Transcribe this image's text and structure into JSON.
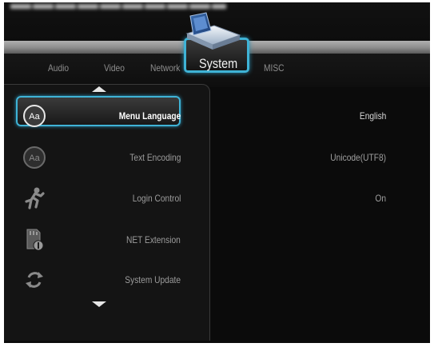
{
  "tabs": [
    {
      "label": "Audio",
      "active": false
    },
    {
      "label": "Video",
      "active": false
    },
    {
      "label": "Network",
      "active": false
    },
    {
      "label": "System",
      "active": true
    },
    {
      "label": "MISC",
      "active": false
    }
  ],
  "settings": [
    {
      "label": "Menu Language",
      "value": "English",
      "icon": "language-icon",
      "selected": true
    },
    {
      "label": "Text Encoding",
      "value": "Unicode(UTF8)",
      "icon": "language-icon",
      "selected": false
    },
    {
      "label": "Login Control",
      "value": "On",
      "icon": "running-man-icon",
      "selected": false
    },
    {
      "label": "NET Extension",
      "value": "",
      "icon": "sd-card-icon",
      "selected": false
    },
    {
      "label": "System Update",
      "value": "",
      "icon": "refresh-icon",
      "selected": false
    }
  ],
  "colors": {
    "accent": "#3fb3d6",
    "background": "#0b0b0b",
    "panel": "#141414",
    "text_dim": "#9c9c9c",
    "text_active": "#ffffff"
  }
}
